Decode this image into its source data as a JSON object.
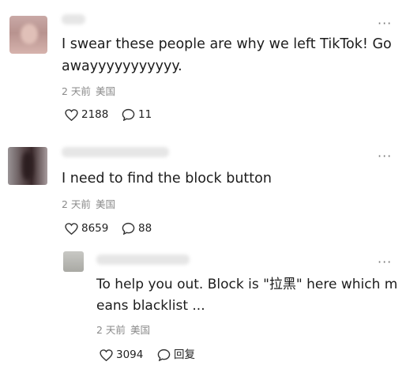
{
  "comments": [
    {
      "text_lines": [
        "I swear these people are why we left TikTok! Go",
        "awayyyyyyyyyyy."
      ],
      "time": "2 天前",
      "location": "美国",
      "likes": "2188",
      "replies": "11"
    },
    {
      "text_lines": [
        "I need to find the block button"
      ],
      "time": "2 天前",
      "location": "美国",
      "likes": "8659",
      "replies": "88"
    },
    {
      "text_lines": [
        "To help you out. Block is \"拉黑\" here which m",
        "eans blacklist ..."
      ],
      "time": "2 天前",
      "location": "美国",
      "likes": "3094",
      "replies": "回复"
    }
  ],
  "more_label": "···"
}
